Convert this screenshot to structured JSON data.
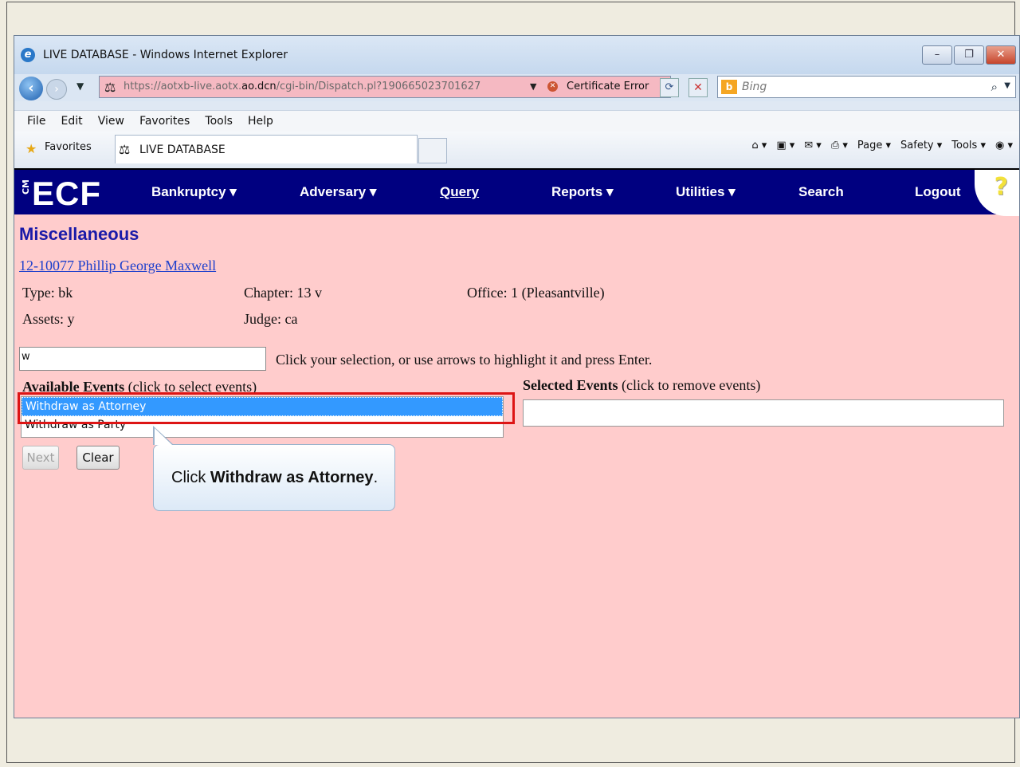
{
  "window": {
    "title": "LIVE DATABASE - Windows Internet Explorer",
    "buttons": [
      "–",
      "❐",
      "✕"
    ]
  },
  "nav": {
    "url_prefix": "https://aotxb-live.aotx.",
    "url_domain": "ao.dcn",
    "url_suffix": "/cgi-bin/Dispatch.pl?190665023701627",
    "cert_error": "Certificate Error",
    "search_placeholder": "Bing"
  },
  "menubar": [
    "File",
    "Edit",
    "View",
    "Favorites",
    "Tools",
    "Help"
  ],
  "favbar": {
    "favorites_label": "Favorites",
    "tab_label": "LIVE DATABASE",
    "commands": [
      "Page ▾",
      "Safety ▾",
      "Tools ▾"
    ]
  },
  "ecf": {
    "logo": "ECF",
    "logo_cm": "CM",
    "menu": {
      "bankruptcy": "Bankruptcy ▾",
      "adversary": "Adversary ▾",
      "query": "Query",
      "reports": "Reports ▾",
      "utilities": "Utilities ▾",
      "search": "Search",
      "logout": "Logout"
    },
    "help": "?"
  },
  "page": {
    "heading": "Miscellaneous",
    "case_link": "12-10077 Phillip George Maxwell",
    "type": "Type: bk",
    "chapter": "Chapter: 13 v",
    "office": "Office: 1 (Pleasantville)",
    "assets": "Assets: y",
    "judge": "Judge: ca",
    "search_value": "w",
    "instruction": "Click your selection, or use arrows to highlight it and press Enter.",
    "available_label_bold": "Available Events",
    "available_label_rest": " (click to select events)",
    "selected_label_bold": "Selected Events",
    "selected_label_rest": " (click to remove events)",
    "available_events": [
      "Withdraw as Attorney",
      "Withdraw as Party"
    ],
    "next_label": "Next",
    "clear_label": "Clear"
  },
  "callout": {
    "prefix": "Click ",
    "bold": "Withdraw as Attorney",
    "suffix": "."
  }
}
